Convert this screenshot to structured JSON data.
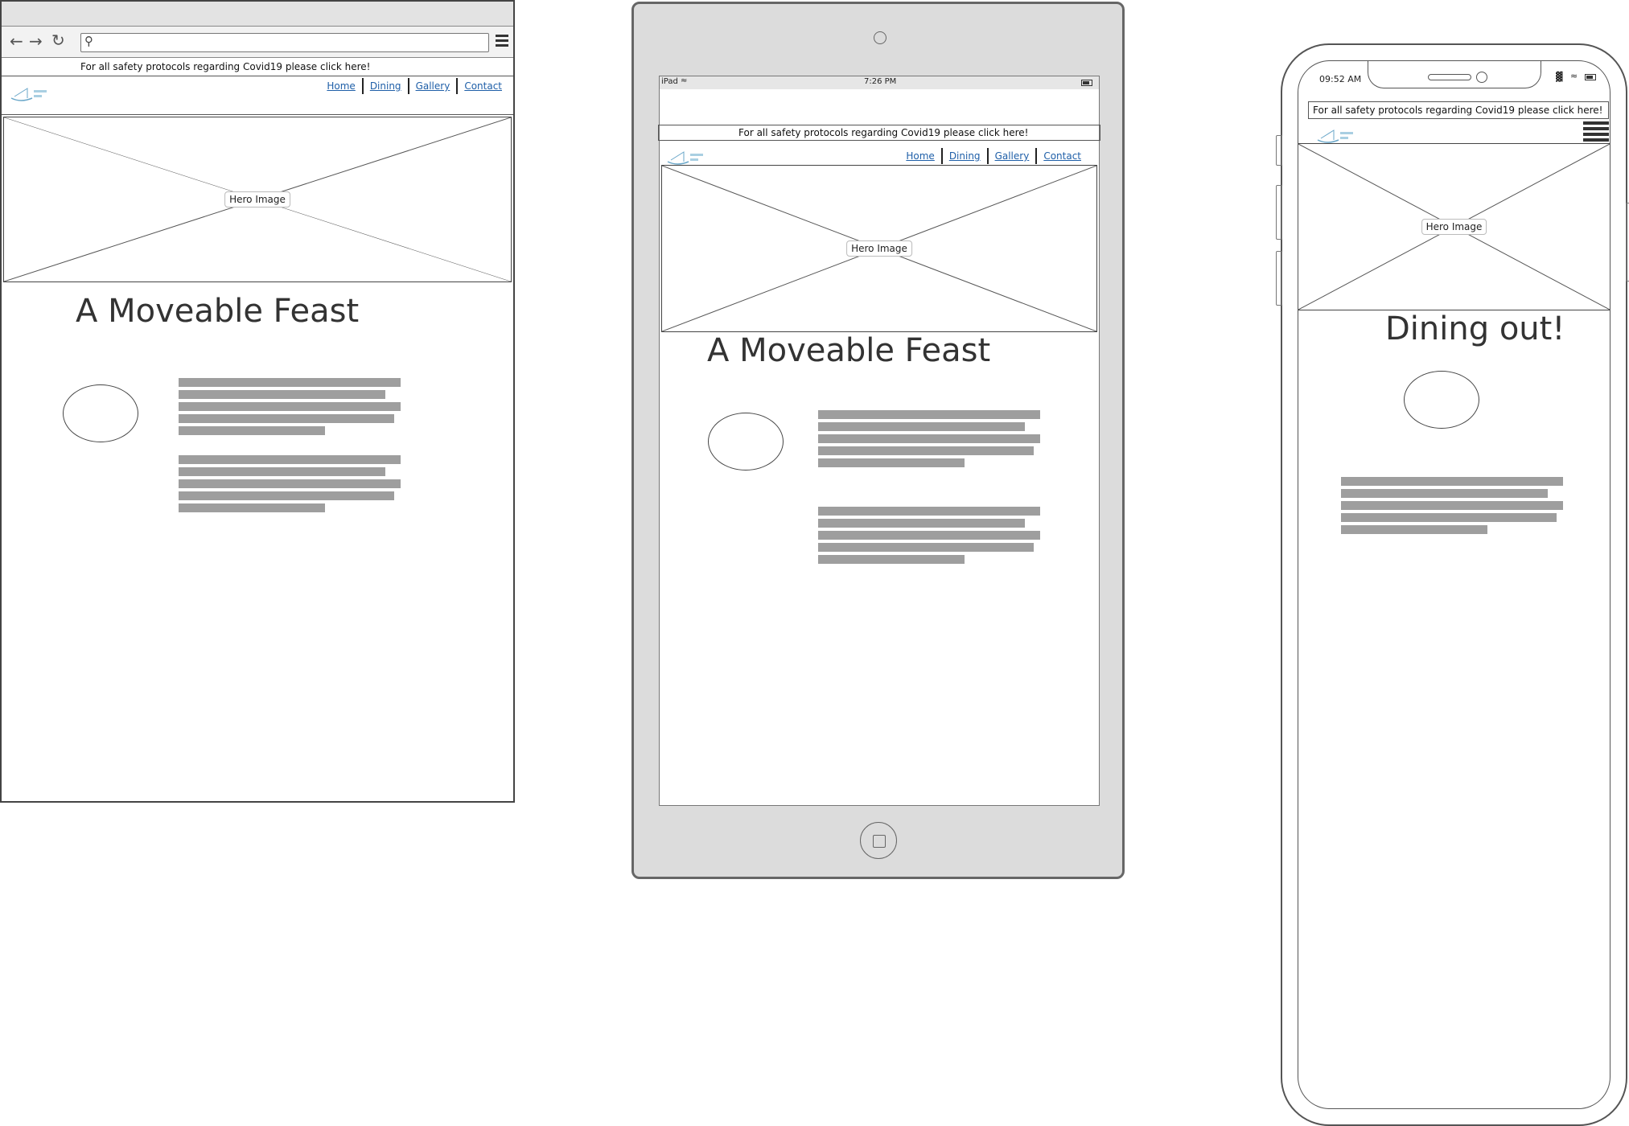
{
  "banner_text": "For all safety protocols regarding Covid19 please click here!",
  "nav": [
    "Home",
    "Dining",
    "Gallery",
    "Contact"
  ],
  "hero_label": "Hero Image",
  "desktop": {
    "title": "A Moveable Feast"
  },
  "tablet": {
    "title": "A Moveable Feast",
    "status_left": "iPad",
    "status_time": "7:26 PM"
  },
  "phone": {
    "title": "Dining out!",
    "status_time": "09:52 AM"
  },
  "colors": {
    "link": "#1f5fa8",
    "placeholder_line": "#9e9e9e",
    "device_frame": "#dcdcdc"
  }
}
